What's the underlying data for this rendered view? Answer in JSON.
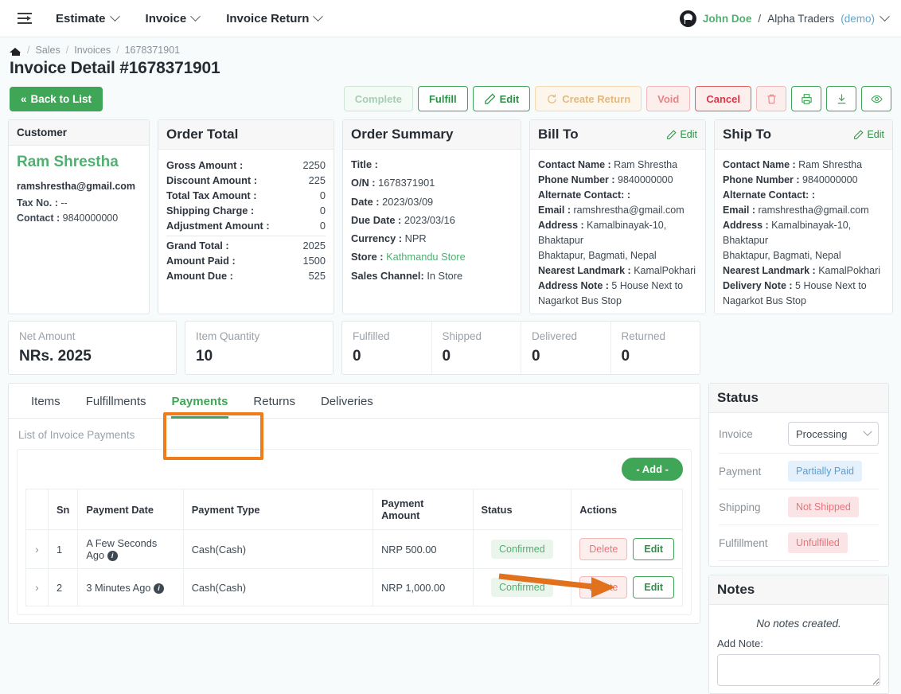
{
  "topnav": {
    "menu_icon": "hamburger-icon",
    "items": [
      {
        "label": "Estimate"
      },
      {
        "label": "Invoice"
      },
      {
        "label": "Invoice Return"
      }
    ],
    "user": {
      "avatar_icon": "github-icon",
      "name": "John Doe",
      "separator": "/",
      "org": "Alpha Traders",
      "mode": "(demo)"
    }
  },
  "breadcrumb": {
    "home_icon": "home-icon",
    "items": [
      "Sales",
      "Invoices",
      "1678371901"
    ],
    "separator": "/"
  },
  "page_title": "Invoice Detail #1678371901",
  "actionbar": {
    "back_label": "Back to List",
    "back_chevron": "«",
    "buttons": [
      {
        "label": "Complete",
        "state": "disabled"
      },
      {
        "label": "Fulfill",
        "state": "enabled"
      },
      {
        "label": "Edit",
        "state": "enabled",
        "icon": "pencil-icon"
      },
      {
        "label": "Create Return",
        "state": "disabled",
        "icon": "refresh-icon"
      },
      {
        "label": "Void",
        "state": "light-red"
      },
      {
        "label": "Cancel",
        "state": "red"
      }
    ],
    "icon_buttons": [
      {
        "icon": "trash-icon",
        "style": "red"
      },
      {
        "icon": "print-icon",
        "style": "green"
      },
      {
        "icon": "download-icon",
        "style": "green"
      },
      {
        "icon": "eye-icon",
        "style": "green"
      }
    ]
  },
  "customer": {
    "title": "Customer",
    "name": "Ram Shrestha",
    "email": "ramshrestha@gmail.com",
    "tax_label": "Tax No. :",
    "tax_value": "--",
    "contact_label": "Contact :",
    "contact_value": "9840000000"
  },
  "order_total": {
    "title": "Order Total",
    "rows": [
      {
        "label": "Gross Amount :",
        "value": "2250"
      },
      {
        "label": "Discount Amount :",
        "value": "225"
      },
      {
        "label": "Total Tax Amount :",
        "value": "0"
      },
      {
        "label": "Shipping Charge :",
        "value": "0"
      },
      {
        "label": "Adjustment Amount :",
        "value": "0"
      },
      {
        "label": "Grand Total :",
        "value": "2025"
      },
      {
        "label": "Amount Paid :",
        "value": "1500"
      },
      {
        "label": "Amount Due :",
        "value": "525"
      }
    ]
  },
  "order_summary": {
    "title": "Order Summary",
    "title_label": "Title :",
    "title_value": "",
    "on_label": "O/N :",
    "on_value": "1678371901",
    "date_label": "Date :",
    "date_value": "2023/03/09",
    "due_label": "Due Date :",
    "due_value": "2023/03/16",
    "currency_label": "Currency :",
    "currency_value": "NPR",
    "store_label": "Store :",
    "store_value": "Kathmandu Store",
    "channel_label": "Sales Channel:",
    "channel_value": "In Store"
  },
  "bill_to": {
    "title": "Bill To",
    "edit_label": "Edit",
    "contact_name_label": "Contact Name :",
    "contact_name": "Ram Shrestha",
    "phone_label": "Phone Number :",
    "phone": "9840000000",
    "alt_label": "Alternate Contact: :",
    "alt": "",
    "email_label": "Email :",
    "email": "ramshrestha@gmail.com",
    "address_label": "Address :",
    "address": "Kamalbinayak-10, Bhaktapur",
    "address_line2": "Bhaktapur, Bagmati, Nepal",
    "landmark_label": "Nearest Landmark :",
    "landmark": "KamalPokhari",
    "note_label": "Address Note :",
    "note": "5 House Next to Nagarkot Bus Stop"
  },
  "ship_to": {
    "title": "Ship To",
    "edit_label": "Edit",
    "contact_name_label": "Contact Name :",
    "contact_name": "Ram Shrestha",
    "phone_label": "Phone Number :",
    "phone": "9840000000",
    "alt_label": "Alternate Contact: :",
    "alt": "",
    "email_label": "Email :",
    "email": "ramshrestha@gmail.com",
    "address_label": "Address :",
    "address": "Kamalbinayak-10, Bhaktapur",
    "address_line2": "Bhaktapur, Bagmati, Nepal",
    "landmark_label": "Nearest Landmark :",
    "landmark": "KamalPokhari",
    "note_label": "Delivery Note :",
    "note": "5 House Next to Nagarkot Bus Stop"
  },
  "stats": {
    "net_amount": {
      "label": "Net Amount",
      "value": "NRs. 2025"
    },
    "item_quantity": {
      "label": "Item Quantity",
      "value": "10"
    },
    "counters": [
      {
        "label": "Fulfilled",
        "value": "0"
      },
      {
        "label": "Shipped",
        "value": "0"
      },
      {
        "label": "Delivered",
        "value": "0"
      },
      {
        "label": "Returned",
        "value": "0"
      }
    ]
  },
  "tabs": [
    {
      "label": "Items",
      "active": false
    },
    {
      "label": "Fulfillments",
      "active": false
    },
    {
      "label": "Payments",
      "active": true
    },
    {
      "label": "Returns",
      "active": false
    },
    {
      "label": "Deliveries",
      "active": false
    }
  ],
  "payments": {
    "subtitle": "List of Invoice Payments",
    "add_label": "- Add -",
    "columns": [
      "",
      "Sn",
      "Payment Date",
      "Payment Type",
      "Payment Amount",
      "Status",
      "Actions"
    ],
    "rows": [
      {
        "expand_icon": "chevron-right-icon",
        "sn": "1",
        "date": "A Few Seconds Ago",
        "info_icon": "info-icon",
        "type": "Cash(Cash)",
        "amount": "NRP 500.00",
        "status": "Confirmed",
        "delete_label": "Delete",
        "edit_label": "Edit"
      },
      {
        "expand_icon": "chevron-right-icon",
        "sn": "2",
        "date": "3 Minutes Ago",
        "info_icon": "info-icon",
        "type": "Cash(Cash)",
        "amount": "NRP 1,000.00",
        "status": "Confirmed",
        "delete_label": "Delete",
        "edit_label": "Edit"
      }
    ]
  },
  "status_panel": {
    "title": "Status",
    "invoice_label": "Invoice",
    "invoice_value": "Processing",
    "payment_label": "Payment",
    "payment_value": "Partially Paid",
    "shipping_label": "Shipping",
    "shipping_value": "Not Shipped",
    "fulfillment_label": "Fulfillment",
    "fulfillment_value": "Unfulfilled"
  },
  "notes_panel": {
    "title": "Notes",
    "empty_text": "No notes created.",
    "add_label": "Add Note:",
    "textarea_value": ""
  },
  "annotations": {
    "highlight_color": "#f07c19",
    "highlight_target": "Payments",
    "arrow_target": "Delete"
  }
}
